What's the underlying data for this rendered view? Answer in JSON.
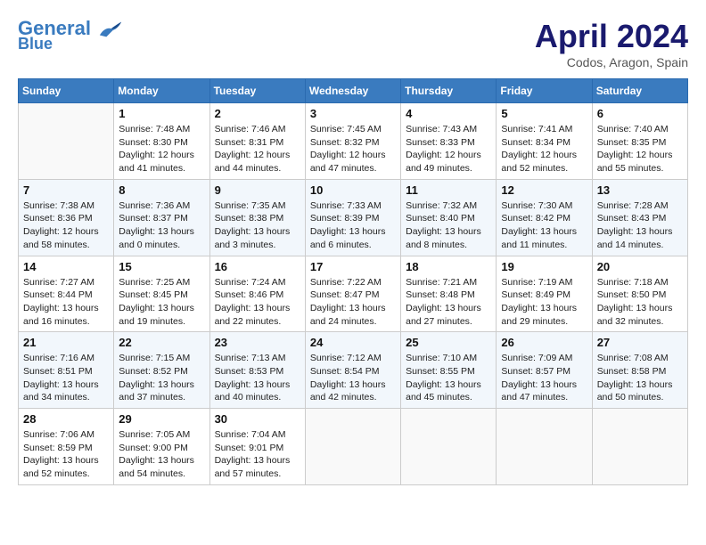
{
  "header": {
    "logo_line1": "General",
    "logo_line2": "Blue",
    "month_title": "April 2024",
    "subtitle": "Codos, Aragon, Spain"
  },
  "weekdays": [
    "Sunday",
    "Monday",
    "Tuesday",
    "Wednesday",
    "Thursday",
    "Friday",
    "Saturday"
  ],
  "weeks": [
    [
      {
        "day": "",
        "info": ""
      },
      {
        "day": "1",
        "info": "Sunrise: 7:48 AM\nSunset: 8:30 PM\nDaylight: 12 hours\nand 41 minutes."
      },
      {
        "day": "2",
        "info": "Sunrise: 7:46 AM\nSunset: 8:31 PM\nDaylight: 12 hours\nand 44 minutes."
      },
      {
        "day": "3",
        "info": "Sunrise: 7:45 AM\nSunset: 8:32 PM\nDaylight: 12 hours\nand 47 minutes."
      },
      {
        "day": "4",
        "info": "Sunrise: 7:43 AM\nSunset: 8:33 PM\nDaylight: 12 hours\nand 49 minutes."
      },
      {
        "day": "5",
        "info": "Sunrise: 7:41 AM\nSunset: 8:34 PM\nDaylight: 12 hours\nand 52 minutes."
      },
      {
        "day": "6",
        "info": "Sunrise: 7:40 AM\nSunset: 8:35 PM\nDaylight: 12 hours\nand 55 minutes."
      }
    ],
    [
      {
        "day": "7",
        "info": "Sunrise: 7:38 AM\nSunset: 8:36 PM\nDaylight: 12 hours\nand 58 minutes."
      },
      {
        "day": "8",
        "info": "Sunrise: 7:36 AM\nSunset: 8:37 PM\nDaylight: 13 hours\nand 0 minutes."
      },
      {
        "day": "9",
        "info": "Sunrise: 7:35 AM\nSunset: 8:38 PM\nDaylight: 13 hours\nand 3 minutes."
      },
      {
        "day": "10",
        "info": "Sunrise: 7:33 AM\nSunset: 8:39 PM\nDaylight: 13 hours\nand 6 minutes."
      },
      {
        "day": "11",
        "info": "Sunrise: 7:32 AM\nSunset: 8:40 PM\nDaylight: 13 hours\nand 8 minutes."
      },
      {
        "day": "12",
        "info": "Sunrise: 7:30 AM\nSunset: 8:42 PM\nDaylight: 13 hours\nand 11 minutes."
      },
      {
        "day": "13",
        "info": "Sunrise: 7:28 AM\nSunset: 8:43 PM\nDaylight: 13 hours\nand 14 minutes."
      }
    ],
    [
      {
        "day": "14",
        "info": "Sunrise: 7:27 AM\nSunset: 8:44 PM\nDaylight: 13 hours\nand 16 minutes."
      },
      {
        "day": "15",
        "info": "Sunrise: 7:25 AM\nSunset: 8:45 PM\nDaylight: 13 hours\nand 19 minutes."
      },
      {
        "day": "16",
        "info": "Sunrise: 7:24 AM\nSunset: 8:46 PM\nDaylight: 13 hours\nand 22 minutes."
      },
      {
        "day": "17",
        "info": "Sunrise: 7:22 AM\nSunset: 8:47 PM\nDaylight: 13 hours\nand 24 minutes."
      },
      {
        "day": "18",
        "info": "Sunrise: 7:21 AM\nSunset: 8:48 PM\nDaylight: 13 hours\nand 27 minutes."
      },
      {
        "day": "19",
        "info": "Sunrise: 7:19 AM\nSunset: 8:49 PM\nDaylight: 13 hours\nand 29 minutes."
      },
      {
        "day": "20",
        "info": "Sunrise: 7:18 AM\nSunset: 8:50 PM\nDaylight: 13 hours\nand 32 minutes."
      }
    ],
    [
      {
        "day": "21",
        "info": "Sunrise: 7:16 AM\nSunset: 8:51 PM\nDaylight: 13 hours\nand 34 minutes."
      },
      {
        "day": "22",
        "info": "Sunrise: 7:15 AM\nSunset: 8:52 PM\nDaylight: 13 hours\nand 37 minutes."
      },
      {
        "day": "23",
        "info": "Sunrise: 7:13 AM\nSunset: 8:53 PM\nDaylight: 13 hours\nand 40 minutes."
      },
      {
        "day": "24",
        "info": "Sunrise: 7:12 AM\nSunset: 8:54 PM\nDaylight: 13 hours\nand 42 minutes."
      },
      {
        "day": "25",
        "info": "Sunrise: 7:10 AM\nSunset: 8:55 PM\nDaylight: 13 hours\nand 45 minutes."
      },
      {
        "day": "26",
        "info": "Sunrise: 7:09 AM\nSunset: 8:57 PM\nDaylight: 13 hours\nand 47 minutes."
      },
      {
        "day": "27",
        "info": "Sunrise: 7:08 AM\nSunset: 8:58 PM\nDaylight: 13 hours\nand 50 minutes."
      }
    ],
    [
      {
        "day": "28",
        "info": "Sunrise: 7:06 AM\nSunset: 8:59 PM\nDaylight: 13 hours\nand 52 minutes."
      },
      {
        "day": "29",
        "info": "Sunrise: 7:05 AM\nSunset: 9:00 PM\nDaylight: 13 hours\nand 54 minutes."
      },
      {
        "day": "30",
        "info": "Sunrise: 7:04 AM\nSunset: 9:01 PM\nDaylight: 13 hours\nand 57 minutes."
      },
      {
        "day": "",
        "info": ""
      },
      {
        "day": "",
        "info": ""
      },
      {
        "day": "",
        "info": ""
      },
      {
        "day": "",
        "info": ""
      }
    ]
  ]
}
